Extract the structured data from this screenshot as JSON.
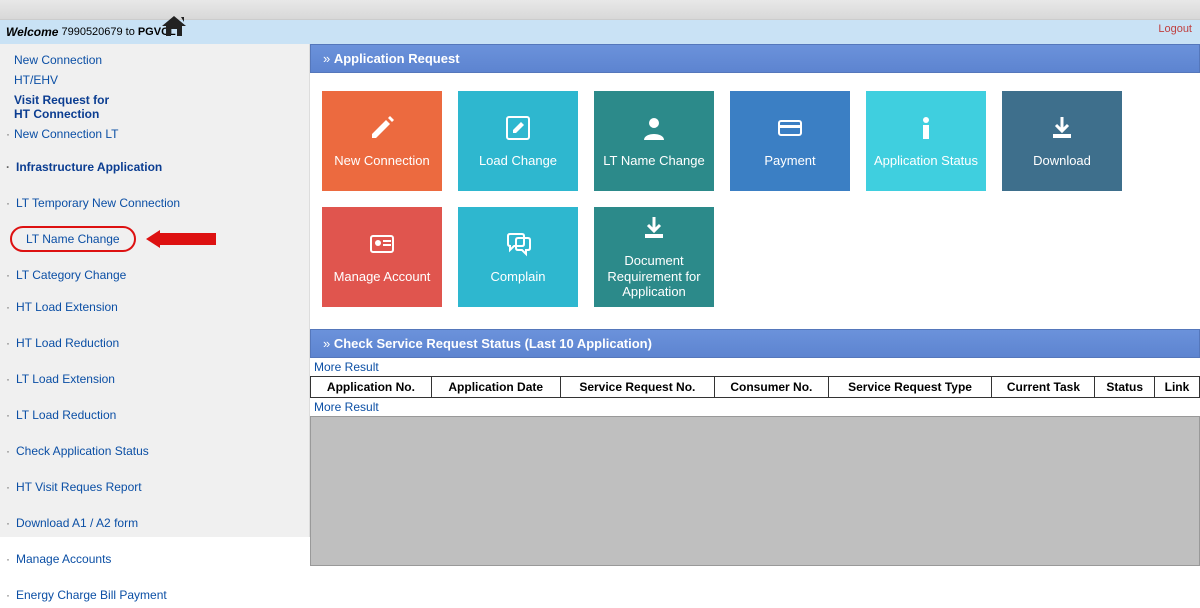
{
  "welcome": {
    "label": "Welcome",
    "number": "7990520679",
    "to": "to",
    "company": "PGVCL"
  },
  "logout": "Logout",
  "sidebar": {
    "items": [
      "New Connection",
      "HT/EHV",
      "Visit Request for",
      "HT Connection",
      "New Connection LT",
      "Infrastructure Application",
      "LT Temporary New Connection",
      "LT Name Change",
      "LT Category Change",
      "HT Load Extension",
      "HT Load Reduction",
      "LT Load Extension",
      "LT Load Reduction",
      "Check Application Status",
      "HT Visit Reques Report",
      "Download A1 / A2 form",
      "Manage Accounts",
      "Energy Charge Bill Payment"
    ]
  },
  "panels": {
    "app_request": "Application Request",
    "status_title": "Check Service Request Status (Last 10 Application)"
  },
  "tiles": {
    "new_connection": "New Connection",
    "load_change": "Load Change",
    "lt_name_change": "LT Name Change",
    "payment": "Payment",
    "app_status": "Application Status",
    "download": "Download",
    "manage_account": "Manage Account",
    "complain": "Complain",
    "doc_req": "Document Requirement for Application"
  },
  "table": {
    "more_result": "More Result",
    "headers": [
      "Application No.",
      "Application Date",
      "Service Request No.",
      "Consumer No.",
      "Service Request Type",
      "Current Task",
      "Status",
      "Link"
    ]
  }
}
